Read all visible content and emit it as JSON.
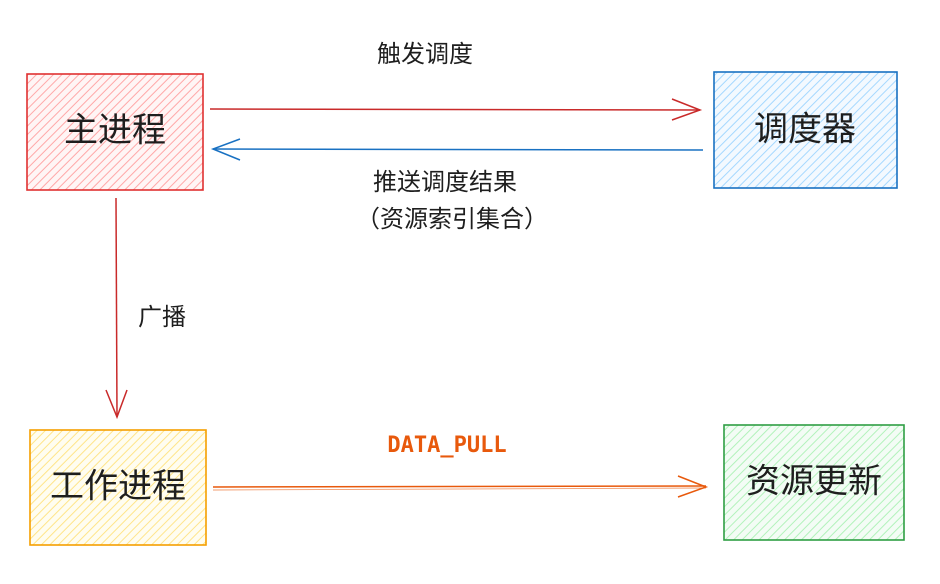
{
  "nodes": {
    "main_process": {
      "label": "主进程",
      "color": "#e03131",
      "fill": "#ffc9c9"
    },
    "scheduler": {
      "label": "调度器",
      "color": "#1971c2",
      "fill": "#a5d8ff"
    },
    "worker_process": {
      "label": "工作进程",
      "color": "#f08c00",
      "fill": "#ffec99"
    },
    "resource_update": {
      "label": "资源更新",
      "color": "#2f9e44",
      "fill": "#b2f2bb"
    }
  },
  "edges": {
    "trigger": {
      "label": "触发调度",
      "color": "#c92a2a"
    },
    "push": {
      "label_line1": "推送调度结果",
      "label_line2": "（资源索引集合）",
      "color": "#1971c2"
    },
    "broadcast": {
      "label": "广播",
      "color": "#c92a2a"
    },
    "data_pull": {
      "label": "DATA_PULL",
      "color": "#e8590c"
    }
  }
}
